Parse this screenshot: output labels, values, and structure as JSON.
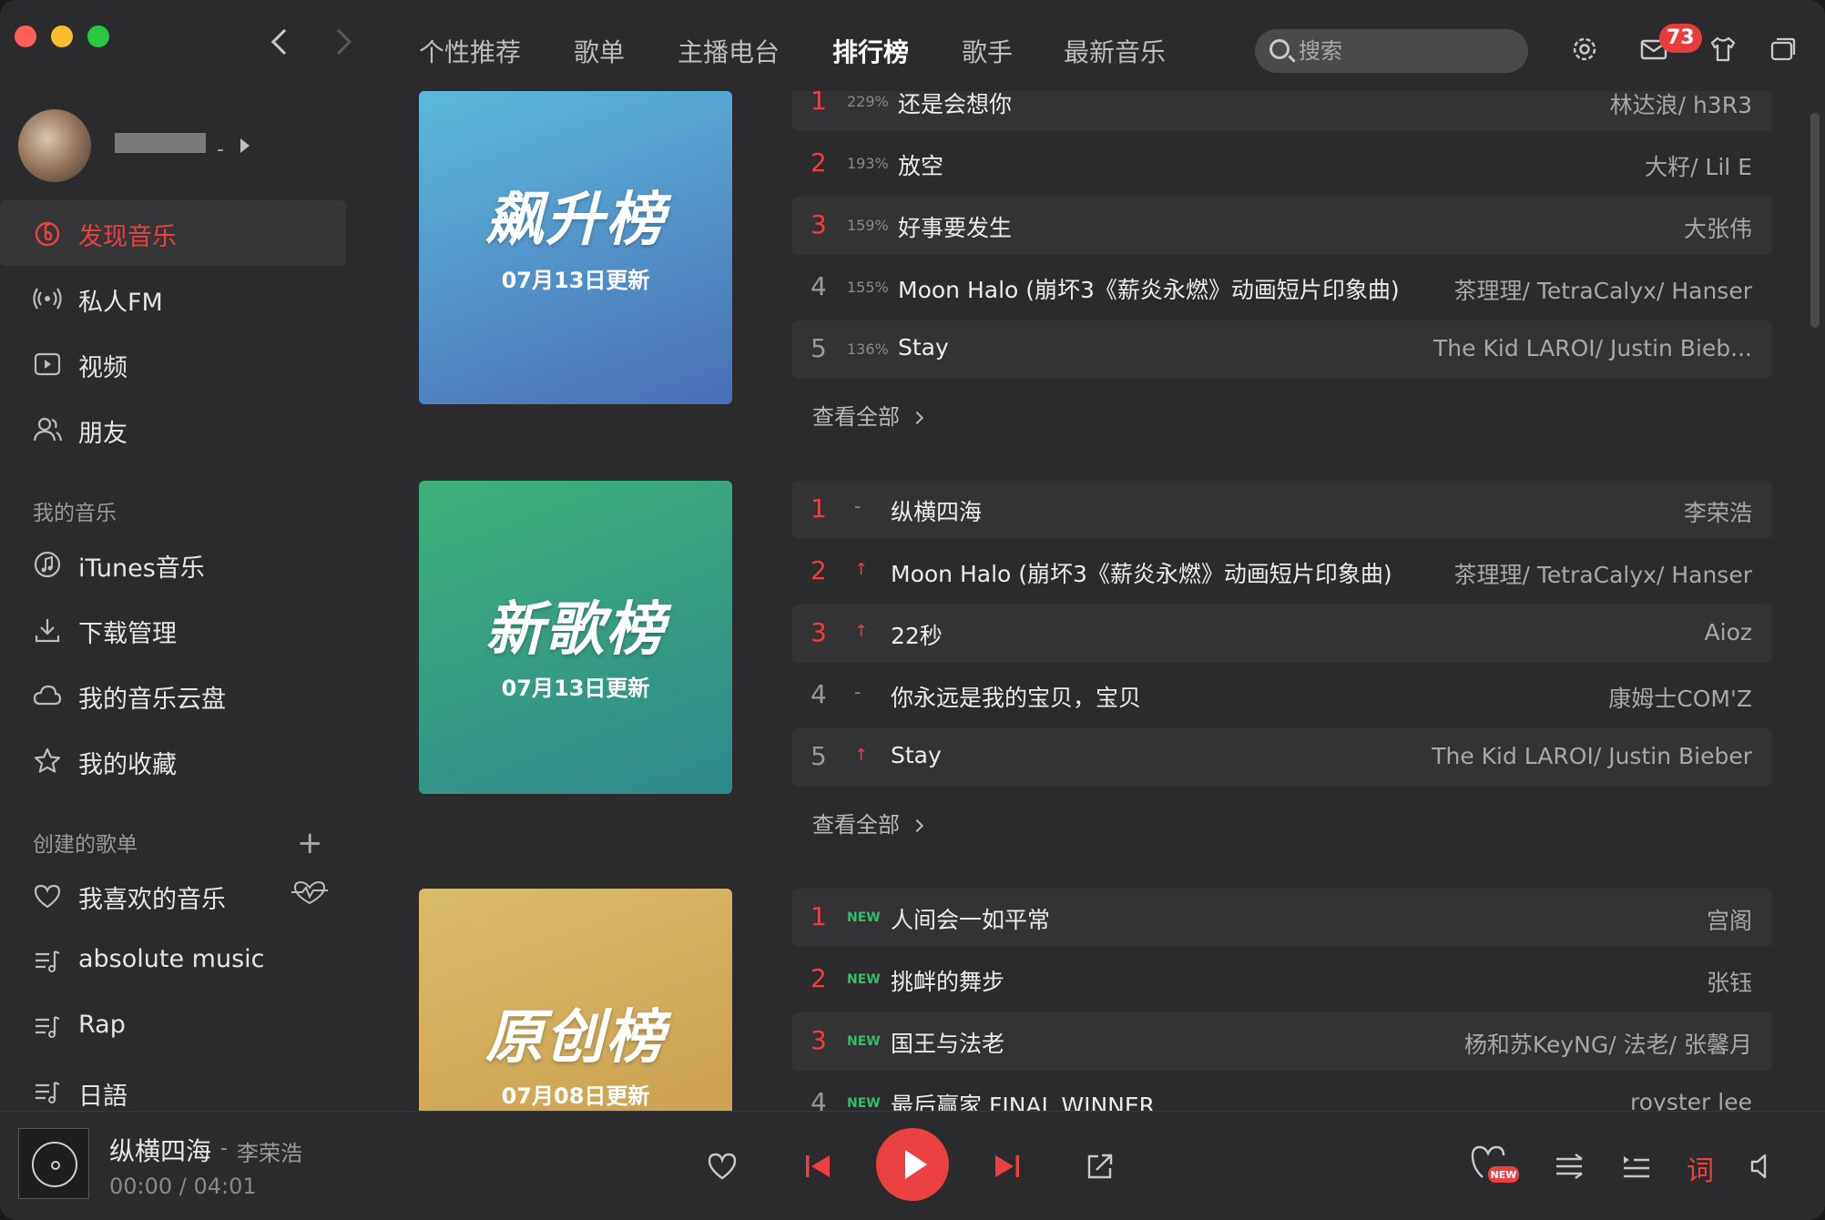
{
  "nav": {
    "tabs": [
      "个性推荐",
      "歌单",
      "主播电台",
      "排行榜",
      "歌手",
      "最新音乐"
    ],
    "active_tab": "排行榜"
  },
  "search": {
    "placeholder": "搜索"
  },
  "messages": {
    "badge_count": "73"
  },
  "user": {
    "name_suffix": "-"
  },
  "sidebar": {
    "main_items": [
      {
        "label": "发现音乐",
        "icon": "netease-logo-icon",
        "active": true
      },
      {
        "label": "私人FM",
        "icon": "radio-icon"
      },
      {
        "label": "视频",
        "icon": "video-icon"
      },
      {
        "label": "朋友",
        "icon": "friends-icon"
      }
    ],
    "my_music_header": "我的音乐",
    "my_music_items": [
      {
        "label": "iTunes音乐",
        "icon": "music-note-icon"
      },
      {
        "label": "下载管理",
        "icon": "download-icon"
      },
      {
        "label": "我的音乐云盘",
        "icon": "cloud-icon"
      },
      {
        "label": "我的收藏",
        "icon": "star-icon"
      }
    ],
    "created_header": "创建的歌单",
    "playlists": [
      {
        "label": "我喜欢的音乐",
        "icon": "heart-icon"
      },
      {
        "label": "absolute music",
        "icon": "playlist-icon"
      },
      {
        "label": "Rap",
        "icon": "playlist-icon"
      },
      {
        "label": "日語",
        "icon": "playlist-icon"
      }
    ]
  },
  "charts": [
    {
      "cover_title": "飙升榜",
      "cover_date": "07月13日更新",
      "colors": [
        "#5bb9dc",
        "#4a6fb8"
      ],
      "tracks": [
        {
          "rank": "1",
          "trend": "229%",
          "title": "还是会想你",
          "artist": "林达浪/ h3R3"
        },
        {
          "rank": "2",
          "trend": "193%",
          "title": "放空",
          "artist": "大籽/ Lil E"
        },
        {
          "rank": "3",
          "trend": "159%",
          "title": "好事要发生",
          "artist": "大张伟"
        },
        {
          "rank": "4",
          "trend": "155%",
          "title": "Moon Halo (崩坏3《薪炎永燃》动画短片印象曲)",
          "artist": "茶理理/ TetraCalyx/ Hanser"
        },
        {
          "rank": "5",
          "trend": "136%",
          "title": "Stay",
          "artist": "The Kid LAROI/ Justin Bieb..."
        }
      ],
      "see_all": "查看全部"
    },
    {
      "cover_title": "新歌榜",
      "cover_date": "07月13日更新",
      "colors": [
        "#3fb07a",
        "#2f8a8c"
      ],
      "tracks": [
        {
          "rank": "1",
          "trend": "-",
          "title": "纵横四海",
          "artist": "李荣浩"
        },
        {
          "rank": "2",
          "trend": "↑",
          "title": "Moon Halo (崩坏3《薪炎永燃》动画短片印象曲)",
          "artist": "茶理理/ TetraCalyx/ Hanser"
        },
        {
          "rank": "3",
          "trend": "↑",
          "title": "22秒",
          "artist": "Aioz"
        },
        {
          "rank": "4",
          "trend": "-",
          "title": "你永远是我的宝贝，宝贝",
          "artist": "康姆士COM'Z"
        },
        {
          "rank": "5",
          "trend": "↑",
          "title": "Stay",
          "artist": "The Kid LAROI/ Justin Bieber"
        }
      ],
      "see_all": "查看全部"
    },
    {
      "cover_title": "原创榜",
      "cover_date": "07月08日更新",
      "colors": [
        "#d9bb6a",
        "#c99a4a"
      ],
      "tracks": [
        {
          "rank": "1",
          "trend": "NEW",
          "title": "人间会一如平常",
          "artist": "宫阁"
        },
        {
          "rank": "2",
          "trend": "NEW",
          "title": "挑衅的舞步",
          "artist": "张钰"
        },
        {
          "rank": "3",
          "trend": "NEW",
          "title": "国王与法老",
          "artist": "杨和苏KeyNG/ 法老/ 张馨月"
        },
        {
          "rank": "4",
          "trend": "NEW",
          "title": "最后赢家 FINAL WINNER",
          "artist": "royster lee"
        }
      ]
    }
  ],
  "player": {
    "title": "纵横四海",
    "separator": "-",
    "artist": "李荣浩",
    "time": "00:00 /  04:01",
    "lyrics_label": "词",
    "new_tag": "NEW"
  },
  "colors": {
    "accent": "#ec4141",
    "new_green": "#2fbf6a",
    "background": "#2b2b2d"
  }
}
